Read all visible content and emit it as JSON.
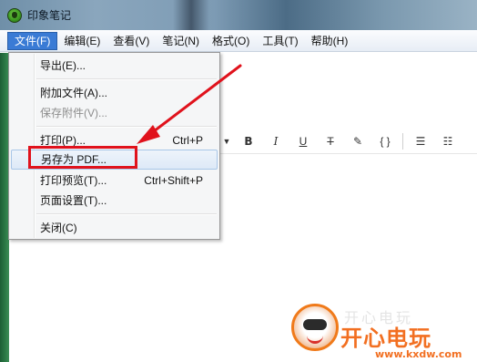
{
  "window": {
    "title": "印象笔记"
  },
  "menubar": {
    "items": [
      "文件(F)",
      "编辑(E)",
      "查看(V)",
      "笔记(N)",
      "格式(O)",
      "工具(T)",
      "帮助(H)"
    ],
    "active_index": 0
  },
  "file_menu": {
    "items": [
      {
        "label": "导出(E)...",
        "shortcut": ""
      },
      {
        "label": "附加文件(A)...",
        "shortcut": ""
      },
      {
        "label": "保存附件(V)...",
        "shortcut": "",
        "disabled": true
      },
      {
        "label": "打印(P)...",
        "shortcut": "Ctrl+P"
      },
      {
        "label": "另存为 PDF...",
        "shortcut": "",
        "highlighted": true
      },
      {
        "label": "打印预览(T)...",
        "shortcut": "Ctrl+Shift+P"
      },
      {
        "label": "页面设置(T)...",
        "shortcut": ""
      },
      {
        "label": "关闭(C)",
        "shortcut": ""
      }
    ]
  },
  "format_toolbar": {
    "dropdown_glyph": "▼",
    "buttons": [
      "B",
      "I",
      "U",
      "T",
      "✎",
      "{ }",
      "☰",
      "☷"
    ]
  },
  "annotation": {
    "color": "#e0121c"
  },
  "watermark": {
    "ghost_text": "开心电玩",
    "brand": "开心电玩",
    "url": "www.kxdw.com",
    "color": "#f26f21"
  }
}
